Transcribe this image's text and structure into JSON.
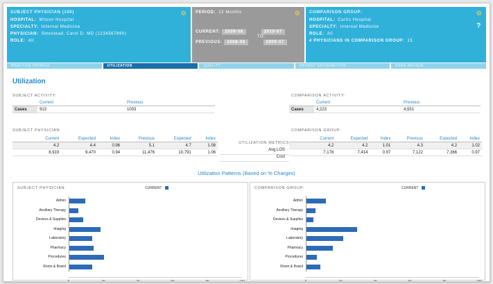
{
  "header": {
    "subject": {
      "title": "SUBJECT PHYSICIAN (100)",
      "rows": [
        {
          "k": "Hospital:",
          "v": "Wilson Hospital"
        },
        {
          "k": "Specialty:",
          "v": "Internal Medicine"
        },
        {
          "k": "Physician:",
          "v": "Smestead, Carol D. MD (1234567890)"
        },
        {
          "k": "Role:",
          "v": "All"
        }
      ]
    },
    "period": {
      "label": "PERIOD:",
      "value": "12 Months",
      "current_label": "CURRENT:",
      "current_from": "2009-08",
      "current_to": "2010-07",
      "to_label": "TO:",
      "previous_label": "PREVIOUS:",
      "previous_from": "2008-08",
      "previous_to": "2009-07"
    },
    "comparison": {
      "title": "COMPARISON GROUP:",
      "rows": [
        {
          "k": "Hospital:",
          "v": "Curtis Hospital"
        },
        {
          "k": "Specialty:",
          "v": "Internal Medicine"
        },
        {
          "k": "Role:",
          "v": "All"
        },
        {
          "k": "# Physicians in Comparison Group:",
          "v": "15"
        }
      ],
      "help": "?"
    }
  },
  "tabs": [
    "PRACTICE PROFILE",
    "UTILIZATION",
    "QUALITY",
    "PATIENT SATISFACTION",
    "PEER REVIEW"
  ],
  "active_tab": 1,
  "page_title": "Utilization",
  "subject_activity": {
    "label": "SUBJECT ACTIVITY:",
    "headers": [
      "Current",
      "Previous"
    ],
    "row_label": "Cases",
    "current": "913",
    "previous": "1033"
  },
  "comparison_activity": {
    "label": "COMPARISON ACTIVITY:",
    "headers": [
      "Current",
      "Previous"
    ],
    "row_label": "Cases",
    "current": "4,223",
    "previous": "4,551"
  },
  "subject_physician_table": {
    "label": "SUBJECT PHYSICIAN:",
    "headers": [
      "Current",
      "Expected",
      "Index",
      "Previous",
      "Expected",
      "Index"
    ],
    "rows": [
      [
        "4.2",
        "4.4",
        "0.96",
        "5.1",
        "4.7",
        "1.08"
      ],
      [
        "8,919",
        "9,470",
        "0.94",
        "11,476",
        "10,791",
        "1.06"
      ]
    ]
  },
  "utilization_metrics": {
    "label": "UTILIZATION METRICS",
    "rows": [
      "Avg LOS",
      "Cost"
    ]
  },
  "comparison_group_table": {
    "label": "COMPARISON GROUP:",
    "headers": [
      "Current",
      "Expected",
      "Index",
      "Previous",
      "Expected",
      "Index"
    ],
    "rows": [
      [
        "4.2",
        "4.2",
        "1.01",
        "4.3",
        "4.2",
        "1.02"
      ],
      [
        "7,178",
        "7,414",
        "0.97",
        "7,122",
        "7,366",
        "0.97"
      ]
    ]
  },
  "patterns_title": "Utilization Patterns (Based on % Charges)",
  "colors": {
    "accent": "#2fb1da",
    "bar": "#2d6bb8",
    "title": "#2a86c4"
  },
  "chart_data": [
    {
      "type": "bar",
      "orientation": "horizontal",
      "title": "SUBJECT PHYSICIAN:",
      "legend": [
        "CURRENT"
      ],
      "categories": [
        "Admin",
        "Ancillary Therapy",
        "Devices & Supplies",
        "Imaging",
        "Laboratory",
        "Pharmacy",
        "Procedures",
        "Room & Board"
      ],
      "series": [
        {
          "name": "CURRENT",
          "values": [
            9,
            5,
            8,
            18,
            13,
            14,
            20,
            13
          ]
        }
      ],
      "xlim": [
        0,
        100
      ],
      "xticks": [
        "0",
        "20",
        "40",
        "60",
        "80",
        "100"
      ]
    },
    {
      "type": "bar",
      "orientation": "horizontal",
      "title": "COMPARISON GROUP:",
      "legend": [
        "CURRENT"
      ],
      "categories": [
        "Admin",
        "Ancillary Therapy",
        "Devices & Supplies",
        "Imaging",
        "Laboratory",
        "Pharmacy",
        "Procedures",
        "Room & Board"
      ],
      "series": [
        {
          "name": "CURRENT",
          "values": [
            11,
            5,
            4,
            29,
            21,
            15,
            6,
            8
          ]
        }
      ],
      "xlim": [
        0,
        100
      ],
      "xticks": [
        "0",
        "20",
        "40",
        "60",
        "80",
        "100"
      ]
    }
  ]
}
